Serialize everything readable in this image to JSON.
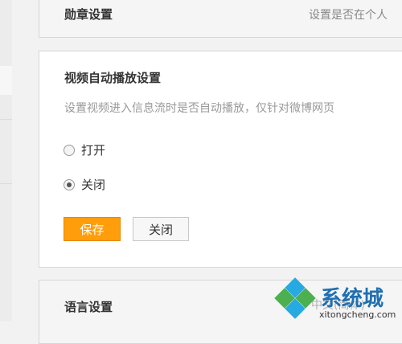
{
  "badge_settings": {
    "title": "勋章设置",
    "hint": "设置是否在个人"
  },
  "video_autoplay": {
    "title": "视频自动播放设置",
    "description": "设置视频进入信息流时是否自动播放，仅针对微博网页",
    "options": [
      {
        "label": "打开",
        "checked": false
      },
      {
        "label": "关闭",
        "checked": true
      }
    ],
    "save_label": "保存",
    "close_label": "关闭",
    "accent_color": "#ff9d0a"
  },
  "language_settings": {
    "title": "语言设置",
    "current": "中文(简体)"
  },
  "watermark": {
    "brand": "系统城",
    "url": "xitongcheng.com"
  }
}
